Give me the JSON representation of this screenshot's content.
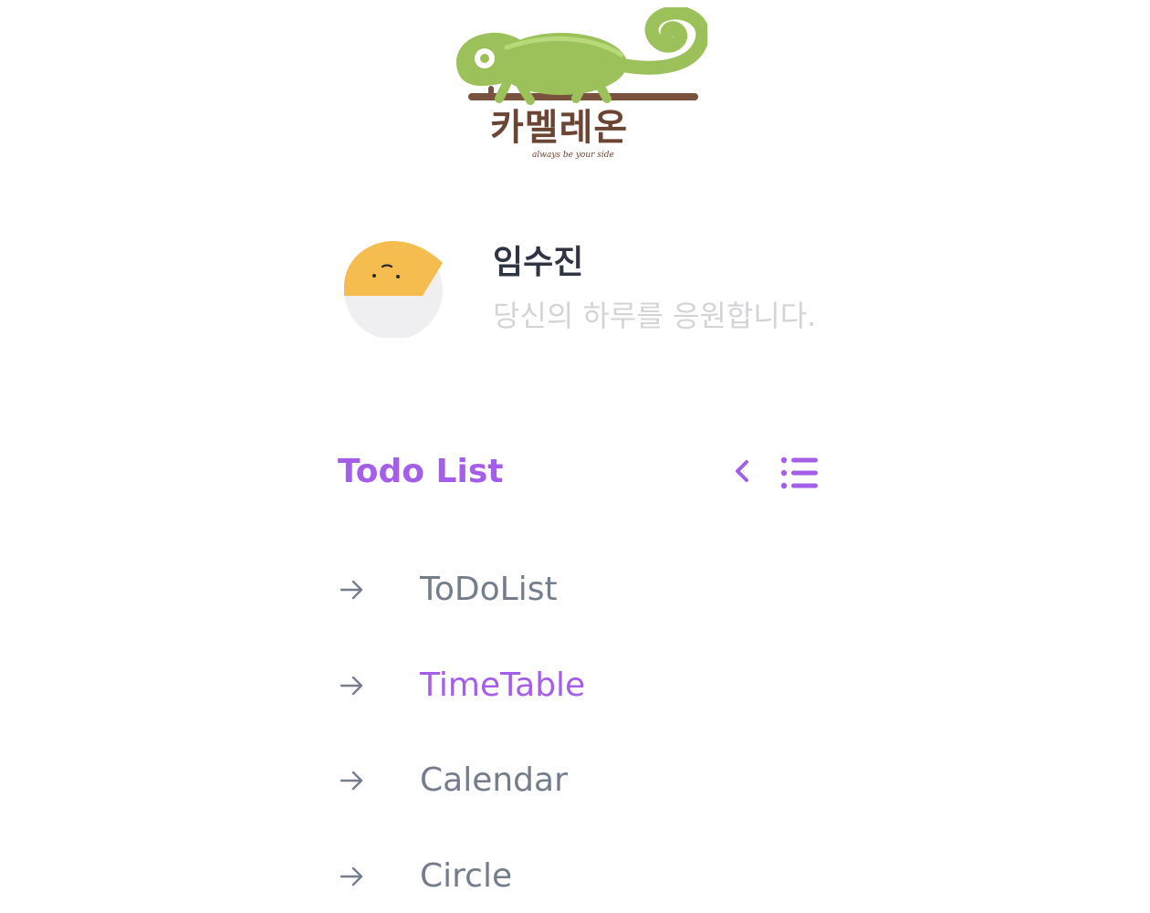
{
  "brand": {
    "logo_text": "카멜레온",
    "tagline": "always be your side"
  },
  "profile": {
    "name": "임수진",
    "greeting": "당신의 하루를 응원합니다."
  },
  "section": {
    "title": "Todo List"
  },
  "nav": {
    "items": [
      {
        "label": "ToDoList",
        "active": false
      },
      {
        "label": "TimeTable",
        "active": true
      },
      {
        "label": "Calendar",
        "active": false
      },
      {
        "label": "Circle",
        "active": false
      }
    ]
  },
  "colors": {
    "accent": "#a55eea",
    "nav_text": "#747d8c",
    "name_text": "#2f3542",
    "greeting_text": "#d4d4d8",
    "avatar_yellow": "#f5bd4f",
    "avatar_gray": "#efeff2",
    "logo_green": "#9cc15a",
    "logo_brown": "#6b4433"
  },
  "icons": {
    "logo": "chameleon-logo",
    "avatar": "avatar-face-icon",
    "collapse": "chevron-left-icon",
    "list": "list-icon",
    "nav_arrow": "arrow-right-icon"
  }
}
